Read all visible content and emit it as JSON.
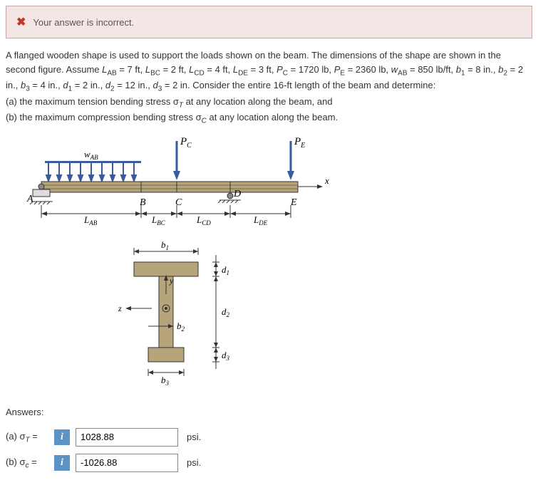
{
  "alert": {
    "icon": "✖",
    "text": "Your answer is incorrect."
  },
  "problem": {
    "line1a": "A flanged wooden shape is used to support the loads shown on the beam. The dimensions of the shape are shown in the second figure. Assume ",
    "LAB_lbl": "L",
    "LAB_sub": "AB",
    "LAB_val": " = 7 ft, ",
    "LBC_lbl": "L",
    "LBC_sub": "BC",
    "LBC_val": " = 2 ft, ",
    "LCD_lbl": "L",
    "LCD_sub": "CD",
    "LCD_val": " = 4 ft, ",
    "LDE_lbl": "L",
    "LDE_sub": "DE",
    "LDE_val": " = 3 ft, ",
    "PC_lbl": "P",
    "PC_sub": "C",
    "PC_val": " = 1720 lb, ",
    "PE_lbl": "P",
    "PE_sub": "E",
    "PE_val": " = 2360 lb, ",
    "wAB_lbl": "w",
    "wAB_sub": "AB",
    "wAB_val": " = 850 lb/ft, ",
    "b1_lbl": "b",
    "b1_sub": "1",
    "b1_val": " = 8 in., ",
    "b2_lbl": "b",
    "b2_sub": "2",
    "b2_val": " = 2 in., ",
    "b3_lbl": "b",
    "b3_sub": "3",
    "b3_val": " = 4 in., ",
    "d1_lbl": "d",
    "d1_sub": "1",
    "d1_val": " = 2 in., ",
    "d2_lbl": "d",
    "d2_sub": "2",
    "d2_val": " = 12 in., ",
    "d3_lbl": "d",
    "d3_sub": "3",
    "d3_val": " = 2 in. ",
    "line1b": "Consider the entire 16-ft length of the beam and determine:",
    "partA": "(a) the maximum tension bending stress σ",
    "partA_sub": "T",
    "partA_end": " at any location along the beam, and",
    "partB": "(b) the maximum compression bending stress σ",
    "partB_sub": "C",
    "partB_end": " at any location along the beam."
  },
  "figure_labels": {
    "PC": "P",
    "PC_s": "C",
    "PE": "P",
    "PE_s": "E",
    "wAB": "w",
    "wAB_s": "AB",
    "x": "x",
    "A": "A",
    "B": "B",
    "C": "C",
    "D": "D",
    "E": "E",
    "LAB": "L",
    "LAB_s": "AB",
    "LBC": "L",
    "LBC_s": "BC",
    "LCD": "L",
    "LCD_s": "CD",
    "LDE": "L",
    "LDE_s": "DE",
    "b1": "b",
    "b1_s": "1",
    "b2": "b",
    "b2_s": "2",
    "b3": "b",
    "b3_s": "3",
    "d1": "d",
    "d1_s": "1",
    "d2": "d",
    "d2_s": "2",
    "d3": "d",
    "d3_s": "3",
    "y": "y",
    "z": "z"
  },
  "answers": {
    "heading": "Answers:",
    "rowA": {
      "label_pre": "(a) σ",
      "label_sub": "T",
      "label_post": " =",
      "value": "1028.88",
      "unit": "psi."
    },
    "rowB": {
      "label_pre": "(b) σ",
      "label_sub": "c",
      "label_post": " =",
      "value": "-1026.88",
      "unit": "psi."
    }
  }
}
